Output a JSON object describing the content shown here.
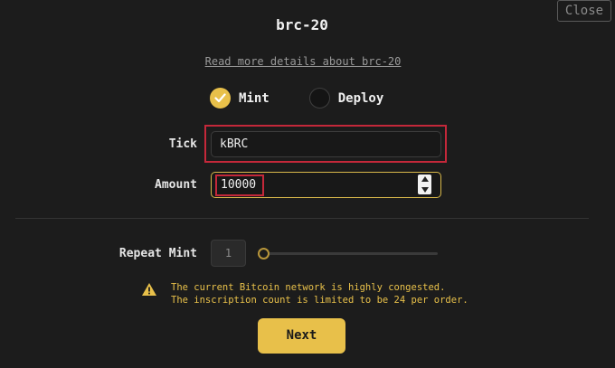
{
  "close_label": "Close",
  "title": "brc-20",
  "details_link": "Read more details about brc-20",
  "mode_options": [
    {
      "label": "Mint",
      "selected": true
    },
    {
      "label": "Deploy",
      "selected": false
    }
  ],
  "fields": {
    "tick_label": "Tick",
    "tick_value": "kBRC",
    "amount_label": "Amount",
    "amount_value": "10000"
  },
  "repeat": {
    "label": "Repeat Mint",
    "value": "1",
    "slider_fraction": 0
  },
  "warning": {
    "icon": "warning-icon",
    "line1": "The current Bitcoin network is highly congested.",
    "line2": "The inscription count is limited to be 24 per order."
  },
  "next_label": "Next",
  "colors": {
    "accent": "#e8c04a",
    "highlight": "#c4283a",
    "background": "#1c1c1c"
  }
}
